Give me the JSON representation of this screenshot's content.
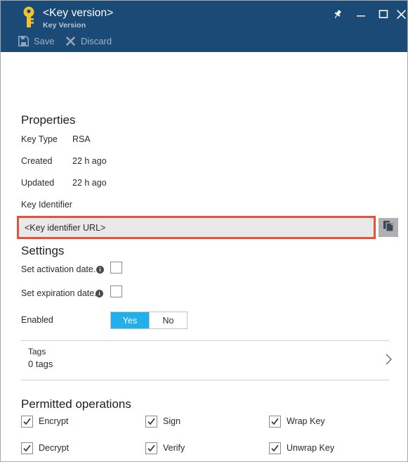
{
  "window": {
    "title": "<Key version>",
    "subtitle": "Key Version",
    "key_icon": "key-icon",
    "controls": [
      {
        "name": "pin-button",
        "icon": "pin-icon"
      },
      {
        "name": "minimize-button",
        "icon": "minimize-icon"
      },
      {
        "name": "maximize-button",
        "icon": "maximize-icon"
      },
      {
        "name": "close-button",
        "icon": "close-icon"
      }
    ]
  },
  "toolbar": {
    "save_label": "Save",
    "save_icon": "save-disk-icon",
    "discard_label": "Discard",
    "discard_icon": "x-cross-icon"
  },
  "properties": {
    "heading": "Properties",
    "rows": [
      {
        "label": "Key Type",
        "value": "RSA"
      },
      {
        "label": "Created",
        "value": "22 h ago"
      },
      {
        "label": "Updated",
        "value": "22 h ago"
      },
      {
        "label": "Key Identifier",
        "value": ""
      }
    ],
    "key_identifier": {
      "value": "<Key identifier URL>",
      "placeholder": "<Key identifier URL>",
      "highlight_color": "#e8503a",
      "field_background": "#e9e9e9",
      "copy_icon": "copy-icon"
    }
  },
  "settings": {
    "heading": "Settings",
    "activation": {
      "label": "Set activation date.",
      "info_icon": "info-icon",
      "checked": false
    },
    "expiration": {
      "label": "Set expiration date.",
      "info_icon": "info-icon",
      "checked": false
    },
    "enabled": {
      "label": "Enabled",
      "yes_label": "Yes",
      "no_label": "No",
      "selected": "Yes",
      "accent_color": "#21b0ea"
    }
  },
  "tags": {
    "title": "Tags",
    "count_text": "0 tags",
    "chevron_icon": "chevron-right-icon"
  },
  "permitted_operations": {
    "heading": "Permitted operations",
    "items": [
      {
        "label": "Encrypt",
        "checked": true
      },
      {
        "label": "Sign",
        "checked": true
      },
      {
        "label": "Wrap Key",
        "checked": true
      },
      {
        "label": "Decrypt",
        "checked": true
      },
      {
        "label": "Verify",
        "checked": true
      },
      {
        "label": "Unwrap Key",
        "checked": true
      }
    ]
  },
  "theme": {
    "titlebar_background": "#1a4a75",
    "key_icon_color": "#f2c230",
    "body_background": "#ffffff"
  }
}
